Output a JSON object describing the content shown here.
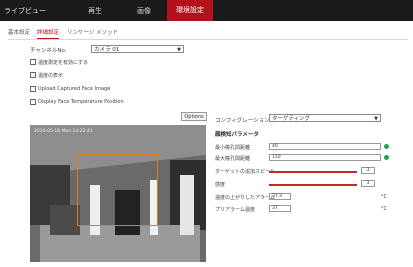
{
  "header": {
    "app_title": "ライブビュー",
    "nav": [
      "再生",
      "画像",
      "環境設定"
    ],
    "active_nav": "環境設定"
  },
  "subtabs": [
    "基本設定",
    "詳細設定",
    "リンケージ メソッド"
  ],
  "channel": {
    "label": "チャンネルNo.",
    "value": "カメラ 01"
  },
  "options": [
    {
      "label": "温度測定を有効にする",
      "checked": false
    },
    {
      "label": "温度の表示",
      "checked": false
    },
    {
      "label": "Upload Captured Face Image",
      "checked": false
    },
    {
      "label": "Display Face Temperature Position",
      "checked": false
    }
  ],
  "buttons": {
    "options": "Options"
  },
  "video": {
    "timestamp": "2020-05-18 Mon 14:22:41"
  },
  "configuration": {
    "label": "コンフィグレーション",
    "value": "ターゲティング"
  },
  "params": {
    "title": "顔検知パラメータ",
    "max_pupil_label": "最小瞳孔間距離",
    "max_pupil_value": "40",
    "min_pupil_label": "最大瞳孔間距離",
    "min_pupil_value": "150",
    "speed_label": "ターゲットの追加スピード",
    "speed_value": "3",
    "sensitivity_label": "感度",
    "sensitivity_value": "3",
    "alarm_label": "温度の上がりしたアラーム",
    "alarm_value": "37.3",
    "alarm_unit": "°C",
    "pre_alarm_label": "プリアラーム温度",
    "pre_alarm_value": "37",
    "pre_alarm_unit": "°C"
  },
  "colors": {
    "accent": "#b3121c",
    "ok": "#22a34a",
    "box": "#e07a1a"
  }
}
